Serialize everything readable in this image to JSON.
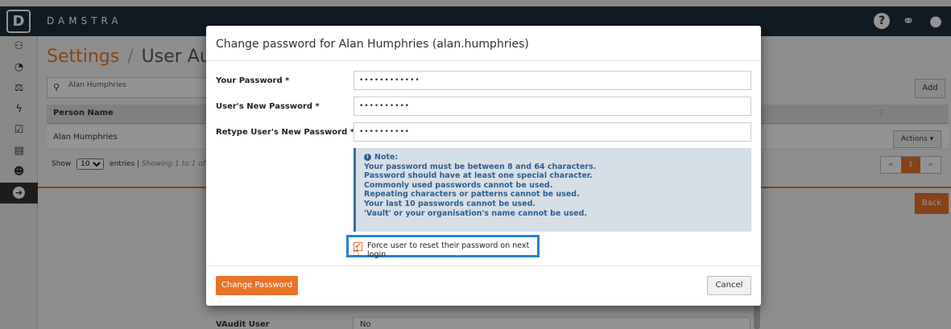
{
  "app": {
    "brand": "DAMSTRA",
    "logo_letter": "D"
  },
  "header": {
    "icons": [
      "help-icon",
      "link-icon",
      "user-icon"
    ],
    "help_glyph": "?"
  },
  "sidebar": {
    "items": [
      {
        "name": "org-chart-icon",
        "glyph": "⚇"
      },
      {
        "name": "dashboard-icon",
        "glyph": "◔"
      },
      {
        "name": "scales-icon",
        "glyph": "⚖"
      },
      {
        "name": "bolt-icon",
        "glyph": "ϟ"
      },
      {
        "name": "checkbox-icon",
        "glyph": "☑"
      },
      {
        "name": "calculator-icon",
        "glyph": "▤"
      },
      {
        "name": "users-icon",
        "glyph": "☻"
      },
      {
        "name": "arrow-right-circle-icon",
        "glyph": "➜"
      }
    ]
  },
  "page": {
    "title_accent": "Settings",
    "separator": "/",
    "title_rest": "User Author",
    "search_value": "Alan Humphries",
    "add_label": "Add",
    "table": {
      "column_person": "Person Name",
      "row_name": "Alan Humphries"
    },
    "show_label": "Show",
    "entries_value": "10",
    "entries_label": "entries",
    "showing_text": "Showing 1 to 1 of 1 entr",
    "actions_label": "Actions ▾",
    "pager": [
      "«",
      "1",
      "»"
    ],
    "back_label": "Back",
    "bottom_field_label": "VAudit User",
    "bottom_field_value": "No"
  },
  "modal": {
    "title": "Change password for Alan Humphries (alan.humphries)",
    "fields": [
      {
        "label": "Your Password *",
        "value": "••••••••••••"
      },
      {
        "label": "User's New Password *",
        "value": "••••••••••"
      },
      {
        "label": "Retype User's New Password *",
        "value": "••••••••••"
      }
    ],
    "note": {
      "title": "Note:",
      "lines": [
        "Your password must be between 8 and 64 characters.",
        "Password should have at least one special character.",
        "Commonly used passwords cannot be used.",
        "Repeating characters or patterns cannot be used.",
        "Your last 10 passwords cannot be used.",
        "'Vault' or your organisation's name cannot be used."
      ]
    },
    "force_reset_label": "Force user to reset their password on next login",
    "force_reset_checked": true,
    "change_button": "Change Password",
    "cancel_button": "Cancel"
  },
  "colors": {
    "accent": "#e8732a",
    "topbar": "#1d2d3d",
    "note_bg": "#d6dfe8",
    "note_text": "#2f5f8e",
    "focus_ring": "#2b7fd8"
  }
}
